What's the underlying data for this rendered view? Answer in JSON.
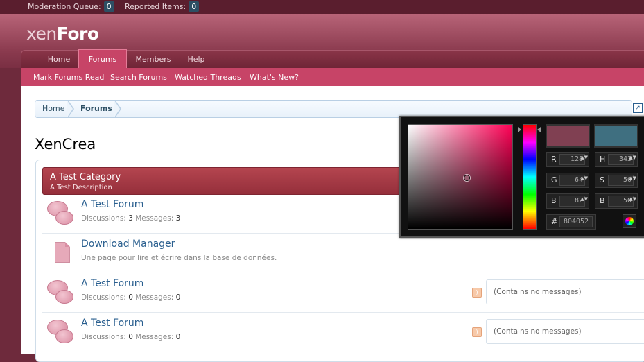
{
  "modbar": {
    "moderation_queue_label": "Moderation Queue:",
    "moderation_queue_count": "0",
    "reported_items_label": "Reported Items:",
    "reported_items_count": "0"
  },
  "logo": {
    "prefix": "xen",
    "suffix": "Foro"
  },
  "tabs": [
    {
      "label": "Home",
      "selected": false
    },
    {
      "label": "Forums",
      "selected": true
    },
    {
      "label": "Members",
      "selected": false
    },
    {
      "label": "Help",
      "selected": false
    }
  ],
  "subnav": [
    "Mark Forums Read",
    "Search Forums",
    "Watched Threads",
    "What's New?"
  ],
  "breadcrumb": [
    "Home",
    "Forums"
  ],
  "page_title": "XenCrea",
  "category": {
    "title": "A Test Category",
    "description": "A Test Description"
  },
  "nodes": [
    {
      "title": "A Test Forum",
      "discussions_label": "Discussions:",
      "discussions": "3",
      "messages_label": "Messages:",
      "messages": "3",
      "icon": "forum-bubbles-icon",
      "lastpost": ""
    },
    {
      "title": "Download Manager",
      "description": "Une page pour lire et écrire dans la base de données.",
      "icon": "page-icon",
      "lastpost": ""
    },
    {
      "title": "A Test Forum",
      "discussions_label": "Discussions:",
      "discussions": "0",
      "messages_label": "Messages:",
      "messages": "0",
      "icon": "forum-bubbles-icon",
      "lastpost": "(Contains no messages)"
    },
    {
      "title": "A Test Forum",
      "discussions_label": "Discussions:",
      "discussions": "0",
      "messages_label": "Messages:",
      "messages": "0",
      "icon": "forum-bubbles-icon",
      "lastpost": "(Contains no messages)"
    }
  ],
  "color_picker": {
    "new_color": "#804052",
    "current_color": "#3f6f80",
    "fields": {
      "r": {
        "label": "R",
        "value": "128"
      },
      "g": {
        "label": "G",
        "value": "64"
      },
      "b": {
        "label": "B",
        "value": "82"
      },
      "h": {
        "label": "H",
        "value": "343"
      },
      "s": {
        "label": "S",
        "value": "50"
      },
      "v": {
        "label": "B",
        "value": "50"
      }
    },
    "hex": {
      "label": "#",
      "value": "804052"
    }
  }
}
